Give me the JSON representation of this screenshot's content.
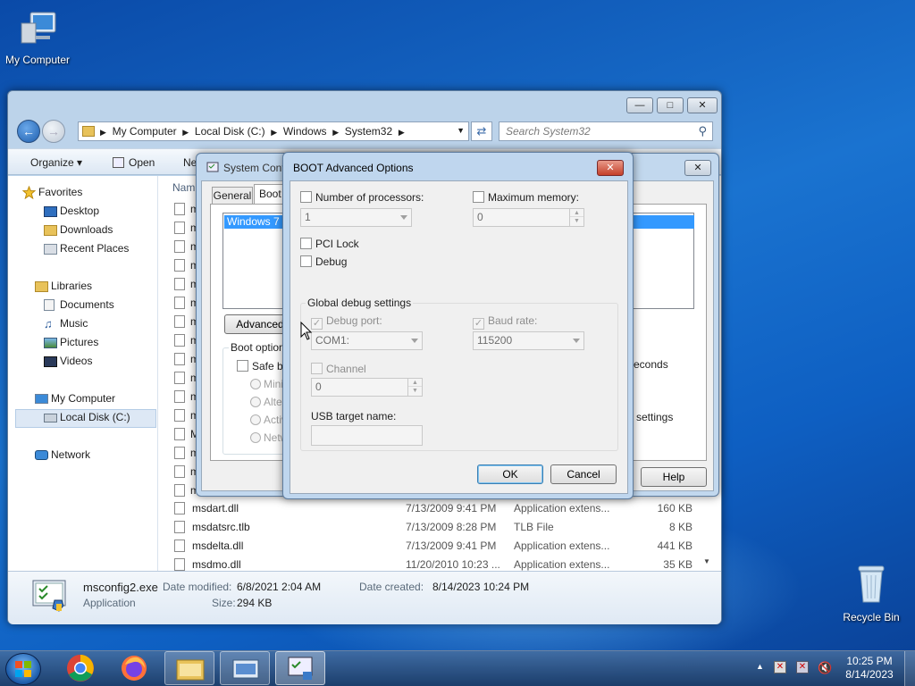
{
  "desktop": {
    "my_computer_label": "My Computer",
    "recycle_bin_label": "Recycle Bin"
  },
  "explorer": {
    "breadcrumb": [
      "My Computer",
      "Local Disk (C:)",
      "Windows",
      "System32"
    ],
    "search_placeholder": "Search System32",
    "toolbar": {
      "organize": "Organize",
      "open": "Open",
      "new_prefix": "Ne"
    },
    "name_header": "Nam",
    "nav": {
      "favorites": "Favorites",
      "desktop": "Desktop",
      "downloads": "Downloads",
      "recent_places": "Recent Places",
      "libraries": "Libraries",
      "documents": "Documents",
      "music": "Music",
      "pictures": "Pictures",
      "videos": "Videos",
      "my_computer": "My Computer",
      "local_disk": "Local Disk (C:)",
      "network": "Network"
    },
    "partial_rows": [
      "m",
      "m",
      "m",
      "m",
      "m",
      "m",
      "m",
      "m",
      "m",
      "m",
      "m",
      "m",
      "M",
      "m",
      "m",
      "m"
    ],
    "files": [
      {
        "name": "msdart.dll",
        "date": "7/13/2009 9:41 PM",
        "type": "Application extens...",
        "size": "160 KB"
      },
      {
        "name": "msdatsrc.tlb",
        "date": "7/13/2009 8:28 PM",
        "type": "TLB File",
        "size": "8 KB"
      },
      {
        "name": "msdelta.dll",
        "date": "7/13/2009 9:41 PM",
        "type": "Application extens...",
        "size": "441 KB"
      },
      {
        "name": "msdmo.dll",
        "date": "11/20/2010 10:23 ...",
        "type": "Application extens...",
        "size": "35 KB"
      }
    ],
    "details": {
      "file_name": "msconfig2.exe",
      "file_type": "Application",
      "date_modified_label": "Date modified:",
      "date_modified": "6/8/2021 2:04 AM",
      "date_created_label": "Date created:",
      "date_created": "8/14/2023 10:24 PM",
      "size_label": "Size:",
      "size": "294 KB"
    }
  },
  "sysconfig": {
    "title": "System Conf",
    "tabs": [
      "General",
      "Boot"
    ],
    "os_entry": "Windows 7 (C",
    "advanced_button": "Advanced o",
    "boot_options_label": "Boot options",
    "safe_boot": "Safe bo",
    "radios": [
      "Minin",
      "Alter",
      "Activ",
      "Netw"
    ],
    "seconds_partial": "econds",
    "settings_partial": "settings",
    "help_button": "Help"
  },
  "boot_advanced": {
    "title": "BOOT Advanced Options",
    "num_processors_label": "Number of processors:",
    "num_processors_value": "1",
    "max_memory_label": "Maximum memory:",
    "max_memory_value": "0",
    "pci_lock_label": "PCI Lock",
    "debug_label": "Debug",
    "global_debug_label": "Global debug settings",
    "debug_port_label": "Debug port:",
    "debug_port_value": "COM1:",
    "baud_rate_label": "Baud rate:",
    "baud_rate_value": "115200",
    "channel_label": "Channel",
    "channel_value": "0",
    "usb_target_label": "USB target name:",
    "ok_button": "OK",
    "cancel_button": "Cancel"
  },
  "taskbar": {
    "time": "10:25 PM",
    "date": "8/14/2023"
  }
}
